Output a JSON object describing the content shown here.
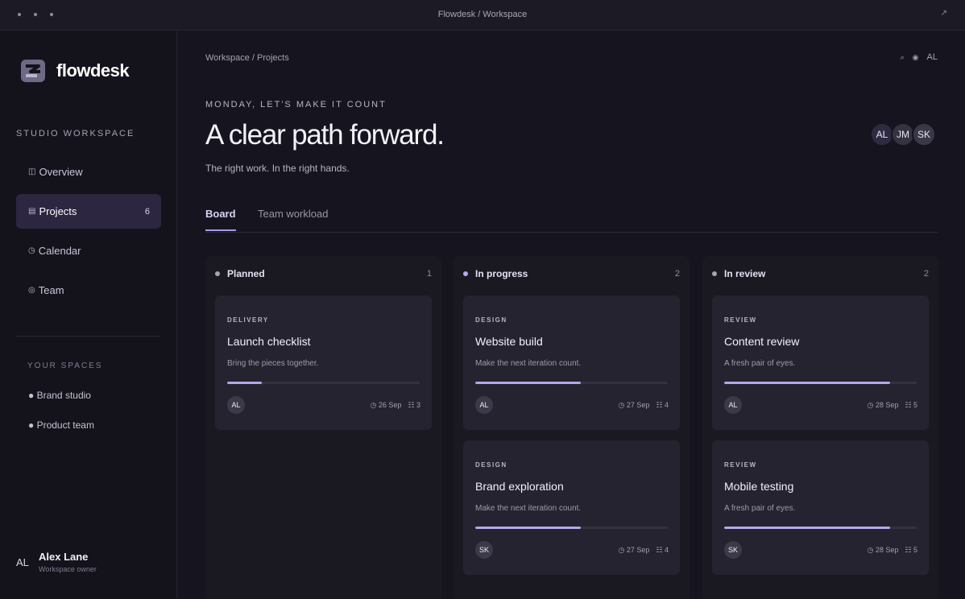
{
  "window": {
    "title": "Flowdesk / Workspace",
    "expand_icon": "expand-icon"
  },
  "sidebar": {
    "brand": "flowdesk",
    "workspace_label": "STUDIO WORKSPACE",
    "nav": [
      {
        "icon": "◫",
        "label": "Overview",
        "count": ""
      },
      {
        "icon": "▤",
        "label": "Projects",
        "count": "6"
      },
      {
        "icon": "◷",
        "label": "Calendar",
        "count": ""
      },
      {
        "icon": "◎",
        "label": "Team",
        "count": ""
      }
    ],
    "spaces_label": "YOUR SPACES",
    "spaces": [
      "● Brand studio",
      "● Product team"
    ],
    "user": {
      "initials": "AL",
      "name": "Alex Lane",
      "role": "Workspace owner"
    }
  },
  "header": {
    "breadcrumb": "Workspace / Projects",
    "search_icon": "⌕",
    "status_icon": "◉",
    "user_initials": "AL",
    "eyebrow": "MONDAY, LET'S MAKE IT COUNT",
    "title": "A clear path forward.",
    "subtitle": "The right work. In the right hands.",
    "team": [
      "AL",
      "JM",
      "SK"
    ]
  },
  "tabs": [
    {
      "label": "Board",
      "active": true
    },
    {
      "label": "Team workload",
      "active": false
    }
  ],
  "columns": [
    {
      "name": "Planned",
      "count": "1",
      "dot_color": "#a7a4b8",
      "cards": [
        {
          "tag": "DELIVERY",
          "title": "Launch checklist",
          "desc": "Bring the pieces together.",
          "progress": 0.18,
          "assignee": "AL",
          "date": "◷ 26 Sep",
          "tasks": "☷ 3"
        }
      ]
    },
    {
      "name": "In progress",
      "count": "2",
      "dot_color": "#b9a8f2",
      "cards": [
        {
          "tag": "DESIGN",
          "title": "Website build",
          "desc": "Make the next iteration count.",
          "progress": 0.55,
          "assignee": "AL",
          "date": "◷ 27 Sep",
          "tasks": "☷ 4"
        },
        {
          "tag": "DESIGN",
          "title": "Brand exploration",
          "desc": "Make the next iteration count.",
          "progress": 0.55,
          "assignee": "SK",
          "date": "◷ 27 Sep",
          "tasks": "☷ 4"
        }
      ]
    },
    {
      "name": "In review",
      "count": "2",
      "dot_color": "#a7a4b8",
      "cards": [
        {
          "tag": "REVIEW",
          "title": "Content review",
          "desc": "A fresh pair of eyes.",
          "progress": 0.86,
          "assignee": "AL",
          "date": "◷ 28 Sep",
          "tasks": "☷ 5"
        },
        {
          "tag": "REVIEW",
          "title": "Mobile testing",
          "desc": "A fresh pair of eyes.",
          "progress": 0.86,
          "assignee": "SK",
          "date": "◷ 28 Sep",
          "tasks": "☷ 5"
        }
      ]
    }
  ]
}
